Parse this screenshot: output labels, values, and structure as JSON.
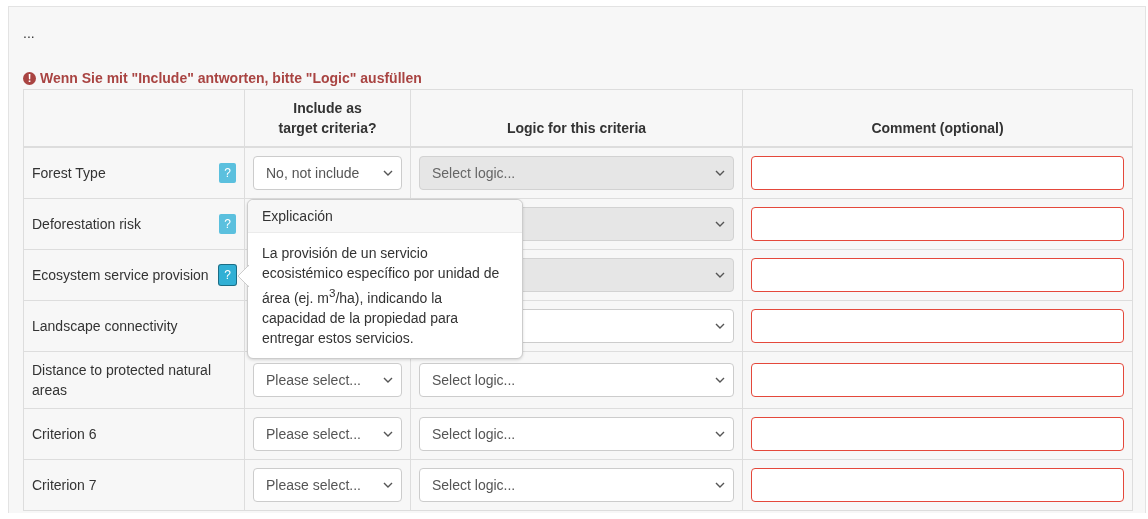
{
  "ellipsis": "...",
  "warning": {
    "icon": "!",
    "text": "Wenn Sie mit \"Include\" antworten, bitte \"Logic\" ausfüllen"
  },
  "table": {
    "columns": {
      "include": "Include as\ntarget criteria?",
      "logic": "Logic for this criteria",
      "comment": "Comment (optional)"
    },
    "rows": [
      {
        "criterion": "Forest Type",
        "help": {
          "icon": "?",
          "active": false
        },
        "include": {
          "value": "No, not include"
        },
        "logic": {
          "value": "Select logic...",
          "disabled": true
        },
        "comment": {
          "invalid": true
        }
      },
      {
        "criterion": "Deforestation risk",
        "help": {
          "icon": "?",
          "active": false
        },
        "logic": {
          "disabled": true
        },
        "comment": {
          "invalid": true
        }
      },
      {
        "criterion": "Ecosystem service provision",
        "help": {
          "icon": "?",
          "active": true
        },
        "logic": {
          "disabled": true
        },
        "comment": {
          "invalid": true
        }
      },
      {
        "criterion": "Landscape connectivity",
        "logic": {
          "disabled": false
        },
        "comment": {
          "invalid": true
        }
      },
      {
        "criterion": "Distance to protected natural areas",
        "include": {
          "value": "Please select..."
        },
        "logic": {
          "value": "Select logic...",
          "disabled": false
        },
        "comment": {
          "invalid": true
        }
      },
      {
        "criterion": "Criterion 6",
        "include": {
          "value": "Please select..."
        },
        "logic": {
          "value": "Select logic...",
          "disabled": false
        },
        "comment": {
          "invalid": true
        }
      },
      {
        "criterion": "Criterion 7",
        "include": {
          "value": "Please select..."
        },
        "logic": {
          "value": "Select logic...",
          "disabled": false
        },
        "comment": {
          "invalid": true
        }
      }
    ]
  },
  "popover": {
    "title": "Explicación",
    "body": "La provisión de un servicio ecosistémico específico por unidad de área (ej. m$^{3}$/ha), indicando la capacidad de la propiedad para entregar estos servicios."
  }
}
